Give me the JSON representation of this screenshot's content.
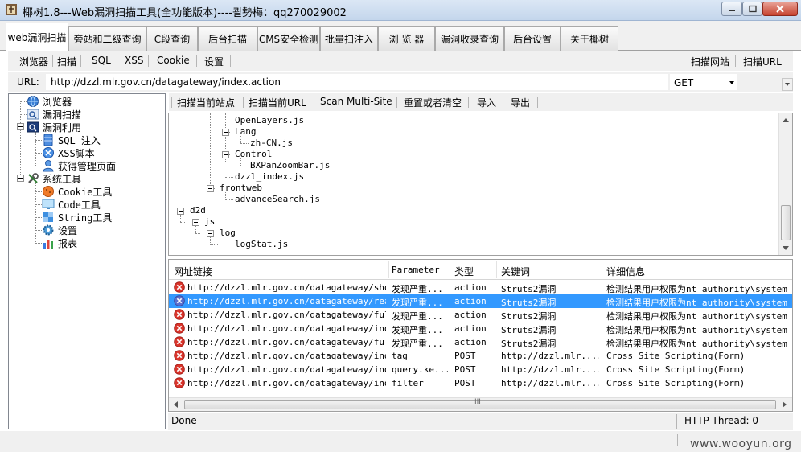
{
  "window": {
    "title": "椰树1.8---Web漏洞扫描工具(全功能版本)----쾰勢梅：qq270029002"
  },
  "tabs": [
    {
      "label": "web漏洞扫描",
      "active": true
    },
    {
      "label": "旁站和二级查询"
    },
    {
      "label": "C段查询"
    },
    {
      "label": "后台扫描"
    },
    {
      "label": "CMS安全检测"
    },
    {
      "label": "批量扫注入"
    },
    {
      "label": "浏 览 器"
    },
    {
      "label": "漏洞收录查询"
    },
    {
      "label": "后台设置"
    },
    {
      "label": "关于椰树"
    }
  ],
  "toolbar": {
    "left": [
      "浏览器",
      "扫描",
      "SQL",
      "XSS",
      "Cookie",
      "设置"
    ],
    "right": [
      "扫描网站",
      "扫描URL"
    ]
  },
  "urlbar": {
    "label": "URL:",
    "value": "http://dzzl.mlr.gov.cn/datagateway/index.action",
    "method": "GET"
  },
  "lefttree": {
    "items": [
      {
        "label": "浏览器",
        "icon": "globe-icon"
      },
      {
        "label": "漏洞扫描",
        "icon": "scan-icon"
      },
      {
        "label": "漏洞利用",
        "icon": "exploit-icon"
      },
      {
        "label": "SQL 注入",
        "icon": "database-icon"
      },
      {
        "label": "XSS脚本",
        "icon": "xss-icon"
      },
      {
        "label": "获得管理页面",
        "icon": "user-icon"
      },
      {
        "label": "系统工具",
        "icon": "tools-icon"
      },
      {
        "label": "Cookie工具",
        "icon": "cookie-icon"
      },
      {
        "label": "Code工具",
        "icon": "monitor-icon"
      },
      {
        "label": "String工具",
        "icon": "puzzle-icon"
      },
      {
        "label": "设置",
        "icon": "gear-icon"
      },
      {
        "label": "报表",
        "icon": "chart-icon"
      }
    ]
  },
  "actions": [
    "扫描当前站点",
    "扫描当前URL",
    "Scan Multi-Site",
    "重置或者清空",
    "导入",
    "导出"
  ],
  "sitetree": {
    "nodes": [
      "OpenLayers.js",
      "Lang",
      "zh-CN.js",
      "Control",
      "BXPanZoomBar.js",
      "dzzl_index.js",
      "frontweb",
      "advanceSearch.js",
      "d2d",
      "js",
      "log",
      "logStat.js"
    ]
  },
  "results": {
    "columns": [
      "网址链接",
      "Parameter",
      "类型",
      "关键词",
      "详细信息"
    ],
    "rows": [
      {
        "url": "http://dzzl.mlr.gov.cn/datagateway/sho...",
        "param": "发现严重...",
        "type": "action",
        "keyword": "Struts2漏洞",
        "detail": "检测结果用户权限为nt authority\\system"
      },
      {
        "url": "http://dzzl.mlr.gov.cn/datagateway/rea...",
        "param": "发现严重...",
        "type": "action",
        "keyword": "Struts2漏洞",
        "detail": "检测结果用户权限为nt authority\\system"
      },
      {
        "url": "http://dzzl.mlr.gov.cn/datagateway/ful...",
        "param": "发现严重...",
        "type": "action",
        "keyword": "Struts2漏洞",
        "detail": "检测结果用户权限为nt authority\\system"
      },
      {
        "url": "http://dzzl.mlr.gov.cn/datagateway/ind...",
        "param": "发现严重...",
        "type": "action",
        "keyword": "Struts2漏洞",
        "detail": "检测结果用户权限为nt authority\\system"
      },
      {
        "url": "http://dzzl.mlr.gov.cn/datagateway/ful...",
        "param": "发现严重...",
        "type": "action",
        "keyword": "Struts2漏洞",
        "detail": "检测结果用户权限为nt authority\\system"
      },
      {
        "url": "http://dzzl.mlr.gov.cn/datagateway/ind...",
        "param": "tag",
        "type": "POST",
        "keyword": "http://dzzl.mlr....",
        "detail": "Cross Site Scripting(Form)"
      },
      {
        "url": "http://dzzl.mlr.gov.cn/datagateway/ind...",
        "param": "query.ke...",
        "type": "POST",
        "keyword": "http://dzzl.mlr....",
        "detail": "Cross Site Scripting(Form)"
      },
      {
        "url": "http://dzzl.mlr.gov.cn/datagateway/ind...",
        "param": "filter",
        "type": "POST",
        "keyword": "http://dzzl.mlr....",
        "detail": "Cross Site Scripting(Form)"
      }
    ],
    "selected_row": 1,
    "hscroll_glyph": "III"
  },
  "status": {
    "text": "Done",
    "thread": "HTTP Thread: 0"
  },
  "watermark": "www.wooyun.org",
  "colors": {
    "selection": "#3399ff",
    "error_icon": "#d9342b"
  }
}
